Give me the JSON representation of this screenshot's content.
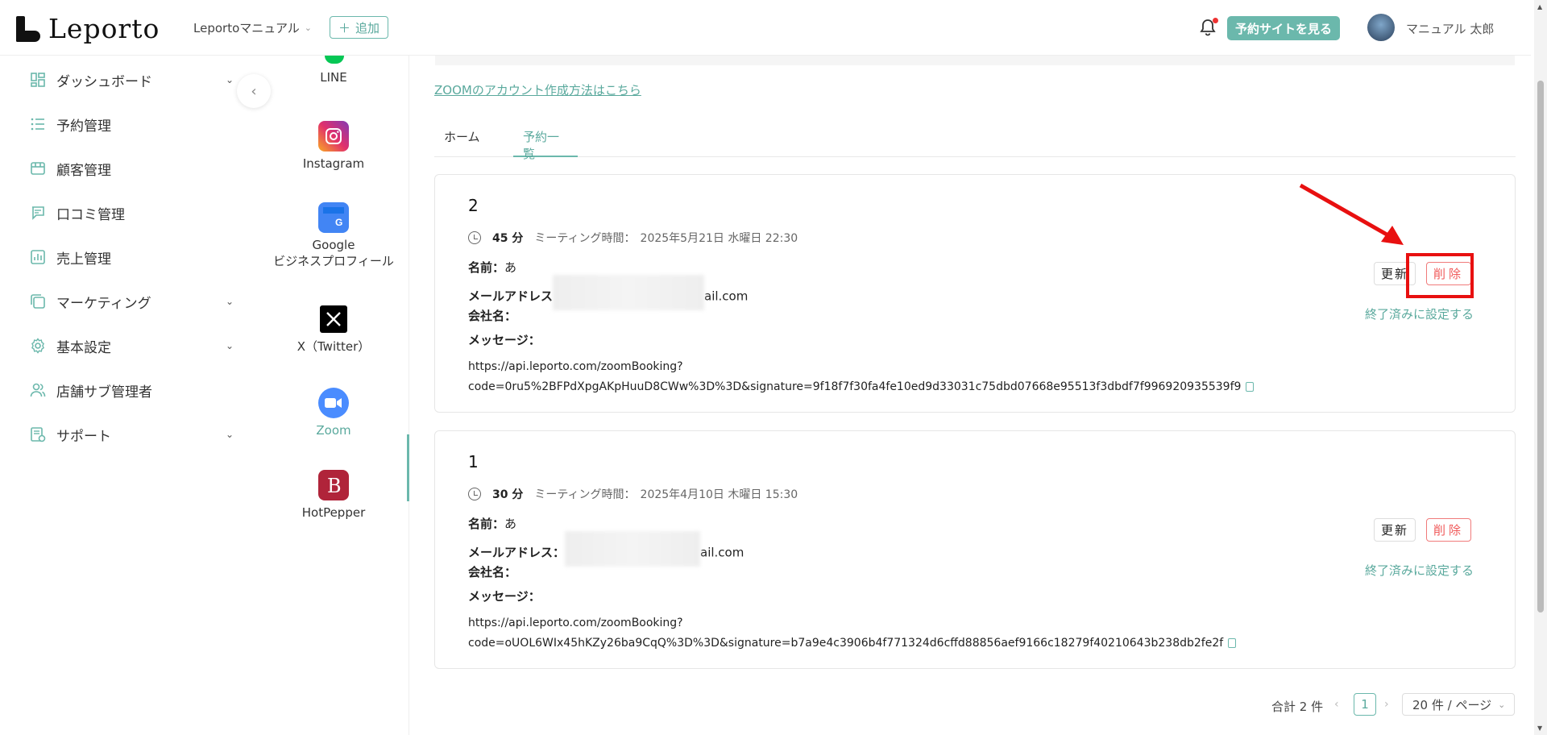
{
  "header": {
    "logo_text": "Leporto",
    "store_select": "Leportoマニュアル",
    "add_label": "追加",
    "site_button": "予約サイトを見る",
    "user_name": "マニュアル 太郎"
  },
  "sidebar": {
    "items": [
      {
        "label": "ダッシュボード",
        "icon": "dashboard-icon",
        "has_caret": true
      },
      {
        "label": "予約管理",
        "icon": "list-icon",
        "has_caret": false
      },
      {
        "label": "顧客管理",
        "icon": "store-icon",
        "has_caret": false
      },
      {
        "label": "口コミ管理",
        "icon": "comment-icon",
        "has_caret": false
      },
      {
        "label": "売上管理",
        "icon": "chart-icon",
        "has_caret": false
      },
      {
        "label": "マーケティング",
        "icon": "copy-icon",
        "has_caret": true
      },
      {
        "label": "基本設定",
        "icon": "gear-icon",
        "has_caret": true
      },
      {
        "label": "店舗サブ管理者",
        "icon": "users-icon",
        "has_caret": false
      },
      {
        "label": "サポート",
        "icon": "support-icon",
        "has_caret": true
      }
    ]
  },
  "integrations": {
    "items": [
      {
        "label": "LINE"
      },
      {
        "label": "Instagram"
      },
      {
        "label": "Google"
      },
      {
        "label": "ビジネスプロフィール"
      },
      {
        "label": "X（Twitter）"
      },
      {
        "label": "Zoom"
      },
      {
        "label": "HotPepper"
      }
    ],
    "active": "Zoom"
  },
  "main": {
    "zoom_link": "ZOOMのアカウント作成方法はこちら",
    "tabs": [
      {
        "label": "ホーム"
      },
      {
        "label": "予約一覧"
      }
    ],
    "labels": {
      "name": "名前：",
      "email": "メールアドレス",
      "email_colon": "メールアドレス：",
      "company": "会社名：",
      "message": "メッセージ：",
      "meeting_time": "ミーティング時間："
    },
    "bookings": [
      {
        "number": "2",
        "duration": "45 分",
        "meeting_datetime": "2025年5月21日 水曜日 22:30",
        "name_value": "あ",
        "email_suffix": "ail.com",
        "url_line1": "https://api.leporto.com/zoomBooking?",
        "url_line2": "code=0ru5%2BFPdXpgAKpHuuD8CWw%3D%3D&signature=9f18f7f30fa4fe10ed9d33031c75dbd07668e95513f3dbdf7f996920935539f9",
        "update_label": "更新",
        "delete_label": "削除",
        "done_label": "終了済みに設定する"
      },
      {
        "number": "1",
        "duration": "30 分",
        "meeting_datetime": "2025年4月10日 木曜日 15:30",
        "name_value": "あ",
        "email_suffix": "ail.com",
        "url_line1": "https://api.leporto.com/zoomBooking?",
        "url_line2": "code=oUOL6WIx45hKZy26ba9CqQ%3D%3D&signature=b7a9e4c3906b4f771324d6cffd88856aef9166c18279f40210643b238db2fe2f",
        "update_label": "更新",
        "delete_label": "削除",
        "done_label": "終了済みに設定する"
      }
    ],
    "pagination": {
      "total": "合計 2 件",
      "current_page": "1",
      "per_page": "20 件 / ページ"
    }
  },
  "colors": {
    "accent": "#6bb8ac",
    "danger": "#f05a5a",
    "highlight": "#e81010"
  }
}
